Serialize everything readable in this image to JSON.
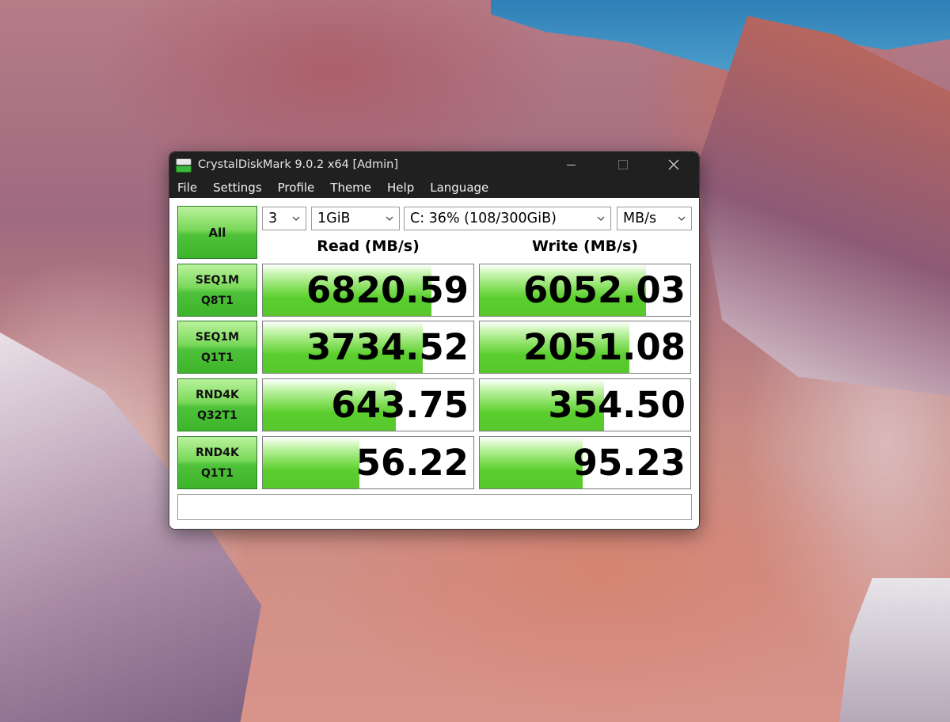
{
  "window": {
    "title": "CrystalDiskMark 9.0.2 x64 [Admin]"
  },
  "menu": [
    "File",
    "Settings",
    "Profile",
    "Theme",
    "Help",
    "Language"
  ],
  "controls": {
    "all_label": "All",
    "count": "3",
    "size": "1GiB",
    "drive": "C: 36% (108/300GiB)",
    "unit": "MB/s"
  },
  "headers": {
    "read": "Read (MB/s)",
    "write": "Write (MB/s)"
  },
  "tests": [
    {
      "line1": "SEQ1M",
      "line2": "Q8T1",
      "read": "6820.59",
      "write": "6052.03",
      "read_fill": 0.8,
      "write_fill": 0.79
    },
    {
      "line1": "SEQ1M",
      "line2": "Q1T1",
      "read": "3734.52",
      "write": "2051.08",
      "read_fill": 0.76,
      "write_fill": 0.71
    },
    {
      "line1": "RND4K",
      "line2": "Q32T1",
      "read": "643.75",
      "write": "354.50",
      "read_fill": 0.63,
      "write_fill": 0.59
    },
    {
      "line1": "RND4K",
      "line2": "Q1T1",
      "read": "56.22",
      "write": "95.23",
      "read_fill": 0.46,
      "write_fill": 0.49
    }
  ],
  "status": ""
}
